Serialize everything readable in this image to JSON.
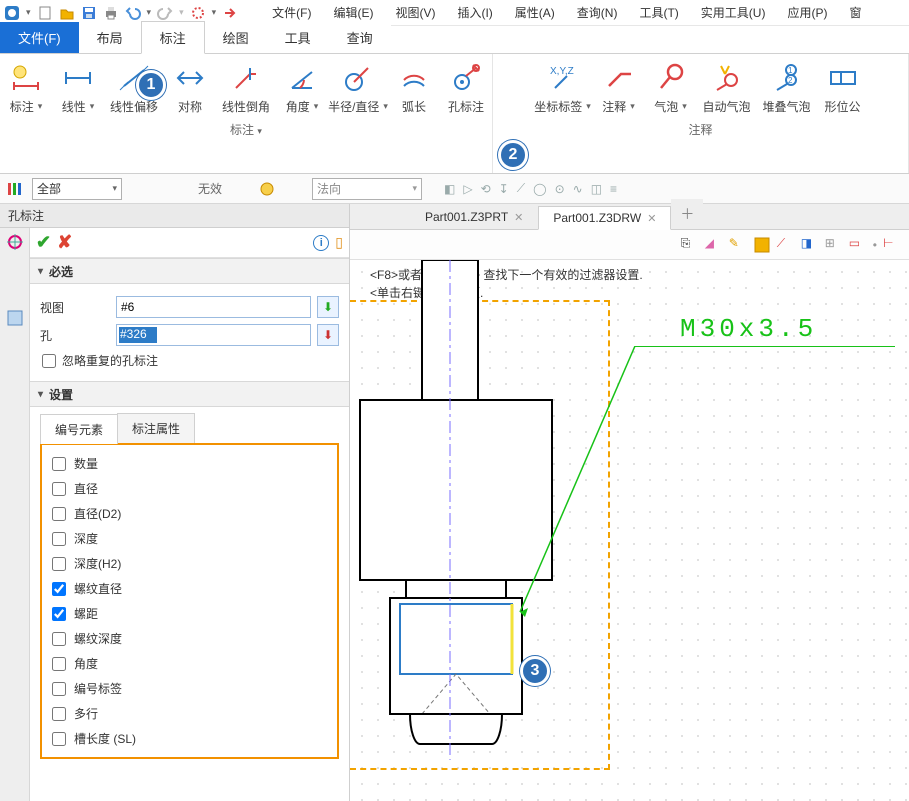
{
  "menu": {
    "file": "文件(F)",
    "edit": "编辑(E)",
    "view": "视图(V)",
    "insert": "插入(I)",
    "attr": "属性(A)",
    "query": "查询(N)",
    "tools": "工具(T)",
    "util": "实用工具(U)",
    "app": "应用(P)",
    "win": "窗"
  },
  "tabs": {
    "file": "文件(F)",
    "layout": "布局",
    "annotate": "标注",
    "draw": "绘图",
    "tool": "工具",
    "query": "查询"
  },
  "ribbon": {
    "group_annotate": "标注",
    "group_note": "注释",
    "btn": {
      "dim": "标注",
      "linear": "线性",
      "linoff": "线性偏移",
      "sym": "对称",
      "linchamf": "线性倒角",
      "angle": "角度",
      "raddia": "半径/直径",
      "arc": "弧长",
      "hole": "孔标注",
      "coord": "坐标标签",
      "note": "注释",
      "balloon": "气泡",
      "autobal": "自动气泡",
      "stackbal": "堆叠气泡",
      "geotol": "形位公"
    }
  },
  "filter": {
    "all": "全部",
    "invalid": "无效",
    "normal": "法向"
  },
  "panel": {
    "title": "孔标注",
    "required": "必选",
    "view_label": "视图",
    "view_value": "#6",
    "hole_label": "孔",
    "hole_value": "#326",
    "ignore_dup": "忽略重复的孔标注",
    "settings": "设置",
    "subtab_elem": "编号元素",
    "subtab_prop": "标注属性",
    "items": {
      "qty": "数量",
      "dia": "直径",
      "dia2": "直径(D2)",
      "depth": "深度",
      "depth2": "深度(H2)",
      "thrdia": "螺纹直径",
      "pitch": "螺距",
      "thrdepth": "螺纹深度",
      "angle": "角度",
      "label": "编号标签",
      "multi": "多行",
      "slot": "槽长度 (SL)"
    }
  },
  "docs": {
    "prt": "Part001.Z3PRT",
    "drw": "Part001.Z3DRW"
  },
  "hints": {
    "l1": "<F8>或者<Shift-roll> 查找下一个有效的过滤器设置.",
    "l2": "<单击右键>获取选项."
  },
  "annotation": "M30x3.5",
  "callouts": {
    "c1": "1",
    "c2": "2",
    "c3": "3"
  }
}
